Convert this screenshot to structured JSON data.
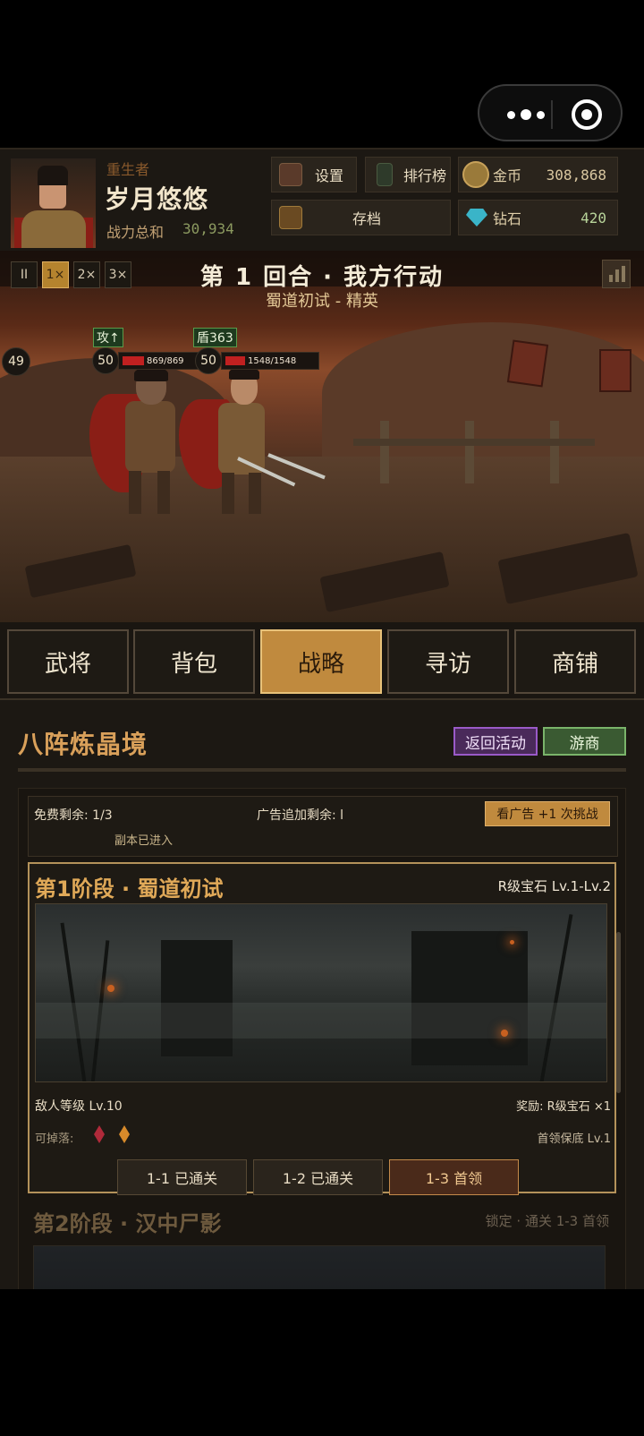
{
  "header": {
    "role": "重生者",
    "player_name": "岁月悠悠",
    "power_label": "战力总和",
    "power_value": "30,934",
    "settings_label": "设置",
    "ranking_label": "排行榜",
    "gold_label": "金币",
    "gold_value": "308,868",
    "save_label": "存档",
    "diamond_label": "钻石",
    "diamond_value": "420"
  },
  "battle": {
    "speed_buttons": [
      "II",
      "1×",
      "2×",
      "3×"
    ],
    "speed_selected": "1×",
    "turn_text": "第 1 回合 · 我方行动",
    "stage_text": "蜀道初试 - 精英",
    "counter": "49",
    "units": [
      {
        "buff": "攻↑",
        "level": "50",
        "hp": "869/869"
      },
      {
        "buff": "盾363",
        "level": "50",
        "hp": "1548/1548"
      }
    ]
  },
  "nav": {
    "tabs": [
      "武将",
      "背包",
      "战略",
      "寻访",
      "商铺"
    ],
    "active": "战略"
  },
  "strategy": {
    "title": "八阵炼晶境",
    "return_button": "返回活动",
    "merchant_button": "游商",
    "free_remaining": "免费剩余: 1/3",
    "ad_remaining": "广告追加剩余: l",
    "entered": "副本已进入",
    "ad_button": "看广告 +1 次挑战",
    "stage1": {
      "title": "第1阶段 · 蜀道初试",
      "reward_range": "R级宝石 Lv.1-Lv.2",
      "enemy_level": "敌人等级 Lv.10",
      "reward": "奖励: R级宝石 ×1",
      "drops_label": "可掉落:",
      "boss_guarantee": "首领保底 Lv.1",
      "levels": [
        "1-1 已通关",
        "1-2 已通关",
        "1-3 首领"
      ]
    },
    "stage2": {
      "title": "第2阶段 · 汉中尸影",
      "lock_text": "锁定 · 通关 1-3 首领"
    }
  },
  "colors": {
    "accent_gold": "#c08a3e",
    "title_orange": "#d9a05a",
    "hp_red": "#c02020",
    "purple_button": "#4a2a5a",
    "green_button": "#3a5a32"
  }
}
